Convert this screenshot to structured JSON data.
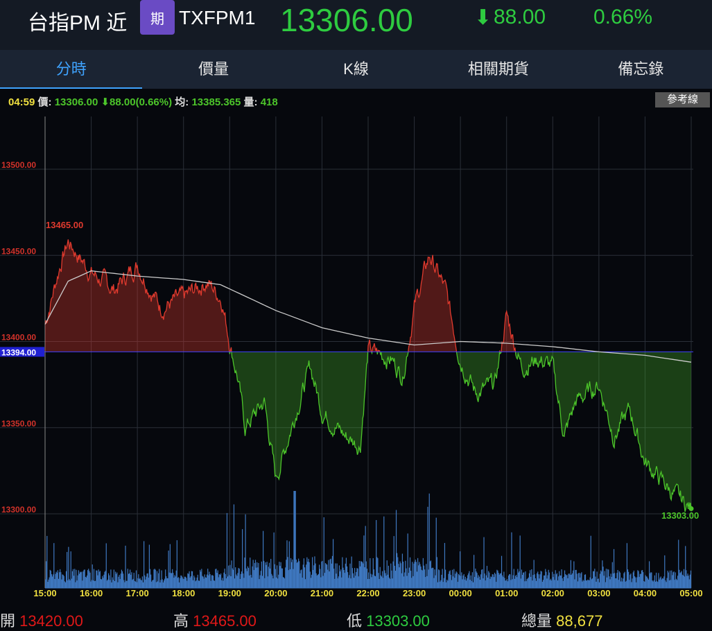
{
  "header": {
    "name": "台指PM 近",
    "badge": "期",
    "symbol": "TXFPM1",
    "price": "13306.00",
    "change": "88.00",
    "change_pct": "0.66%",
    "down_color": "#2ecc40"
  },
  "tabs": [
    {
      "label": "分時"
    },
    {
      "label": "價量"
    },
    {
      "label": "K線"
    },
    {
      "label": "相關期貨"
    },
    {
      "label": "備忘錄"
    }
  ],
  "info": {
    "time": "04:59",
    "price_label": "價:",
    "price": "13306.00",
    "change": "88.00(0.66%)",
    "avg_label": "均:",
    "avg": "13385.365",
    "vol_label": "量:",
    "vol": "418"
  },
  "ref_button": "參考線",
  "chart_data": {
    "type": "line",
    "y_ticks": [
      "13500.00",
      "13450.00",
      "13400.00",
      "13350.00",
      "13300.00"
    ],
    "y_values": [
      13500,
      13450,
      13400,
      13350,
      13300
    ],
    "reference": 13394,
    "reference_label": "13394.00",
    "high_label": "13465.00",
    "last_label": "13303.00",
    "x_ticks": [
      "15:00",
      "16:00",
      "17:00",
      "18:00",
      "19:00",
      "20:00",
      "21:00",
      "22:00",
      "23:00",
      "00:00",
      "01:00",
      "02:00",
      "03:00",
      "04:00",
      "05:00"
    ],
    "price_keypoints_hours_from_15": [
      [
        0,
        13410
      ],
      [
        0.33,
        13445
      ],
      [
        0.5,
        13458
      ],
      [
        1,
        13440
      ],
      [
        1.5,
        13430
      ],
      [
        2,
        13445
      ],
      [
        2.5,
        13420
      ],
      [
        3,
        13425
      ],
      [
        3.5,
        13435
      ],
      [
        3.83,
        13425
      ],
      [
        4,
        13400
      ],
      [
        4.17,
        13380
      ],
      [
        4.33,
        13350
      ],
      [
        4.75,
        13365
      ],
      [
        5,
        13320
      ],
      [
        5.5,
        13365
      ],
      [
        5.75,
        13385
      ],
      [
        6,
        13360
      ],
      [
        6.5,
        13345
      ],
      [
        6.83,
        13340
      ],
      [
        7,
        13395
      ],
      [
        7.5,
        13390
      ],
      [
        7.75,
        13380
      ],
      [
        8,
        13420
      ],
      [
        8.33,
        13450
      ],
      [
        8.67,
        13430
      ],
      [
        9,
        13390
      ],
      [
        9.33,
        13370
      ],
      [
        9.75,
        13375
      ],
      [
        10,
        13415
      ],
      [
        10.33,
        13385
      ],
      [
        10.67,
        13390
      ],
      [
        11,
        13385
      ],
      [
        11.25,
        13345
      ],
      [
        11.5,
        13365
      ],
      [
        12,
        13375
      ],
      [
        12.33,
        13345
      ],
      [
        12.67,
        13360
      ],
      [
        13,
        13330
      ],
      [
        13.33,
        13320
      ],
      [
        13.67,
        13310
      ],
      [
        14,
        13303
      ]
    ],
    "avg_keypoints_hours_from_15": [
      [
        0,
        13410
      ],
      [
        0.5,
        13435
      ],
      [
        1,
        13441
      ],
      [
        2,
        13438
      ],
      [
        3,
        13436
      ],
      [
        3.8,
        13433
      ],
      [
        5,
        13418
      ],
      [
        6,
        13408
      ],
      [
        7,
        13402
      ],
      [
        8,
        13398
      ],
      [
        9,
        13400
      ],
      [
        10,
        13399
      ],
      [
        11,
        13397
      ],
      [
        12,
        13394
      ],
      [
        13,
        13392
      ],
      [
        14,
        13388
      ]
    ],
    "price_color": "#e03a2e",
    "down_color": "#4cc52a",
    "avg_color": "#cccccc",
    "volume_color": "#3f78c0"
  },
  "footer": {
    "open_label": "開",
    "open": "13420.00",
    "high_label": "高",
    "high": "13465.00",
    "low_label": "低",
    "low": "13303.00",
    "vol_label": "總量",
    "vol": "88,677"
  }
}
